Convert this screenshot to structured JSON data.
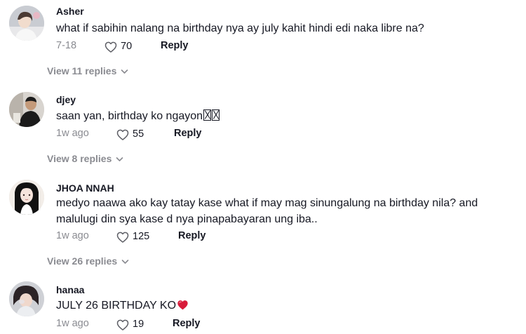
{
  "comments": [
    {
      "username": "Asher",
      "text": "what if sabihin nalang na birthday nya ay july kahit hindi edi naka libre na?",
      "date": "7-18",
      "likes": "70",
      "reply_label": "Reply",
      "view_replies": "View 11 replies"
    },
    {
      "username": "djey",
      "text": "saan yan, birthday ko ngayon",
      "date": "1w ago",
      "likes": "55",
      "reply_label": "Reply",
      "view_replies": "View 8 replies"
    },
    {
      "username": "JHOA NNAH",
      "text": "medyo naawa ako kay tatay kase what if may mag sinungalung na birthday nila? and malulugi din sya kase d nya pinapabayaran ung iba..",
      "date": "1w ago",
      "likes": "125",
      "reply_label": "Reply",
      "view_replies": "View 26 replies"
    },
    {
      "username": "hanaa",
      "text": "JULY 26 BIRTHDAY KO",
      "date": "1w ago",
      "likes": "19",
      "reply_label": "Reply"
    }
  ],
  "colors": {
    "primary_text": "#161823",
    "secondary_text": "#8a8b91",
    "heart_emoji": "#d81b3a"
  },
  "icons": {
    "like": "heart-outline-icon",
    "expand": "chevron-down-icon",
    "emoji": "red-heart-emoji-icon",
    "missing_glyph": "unrendered-emoji-box"
  }
}
